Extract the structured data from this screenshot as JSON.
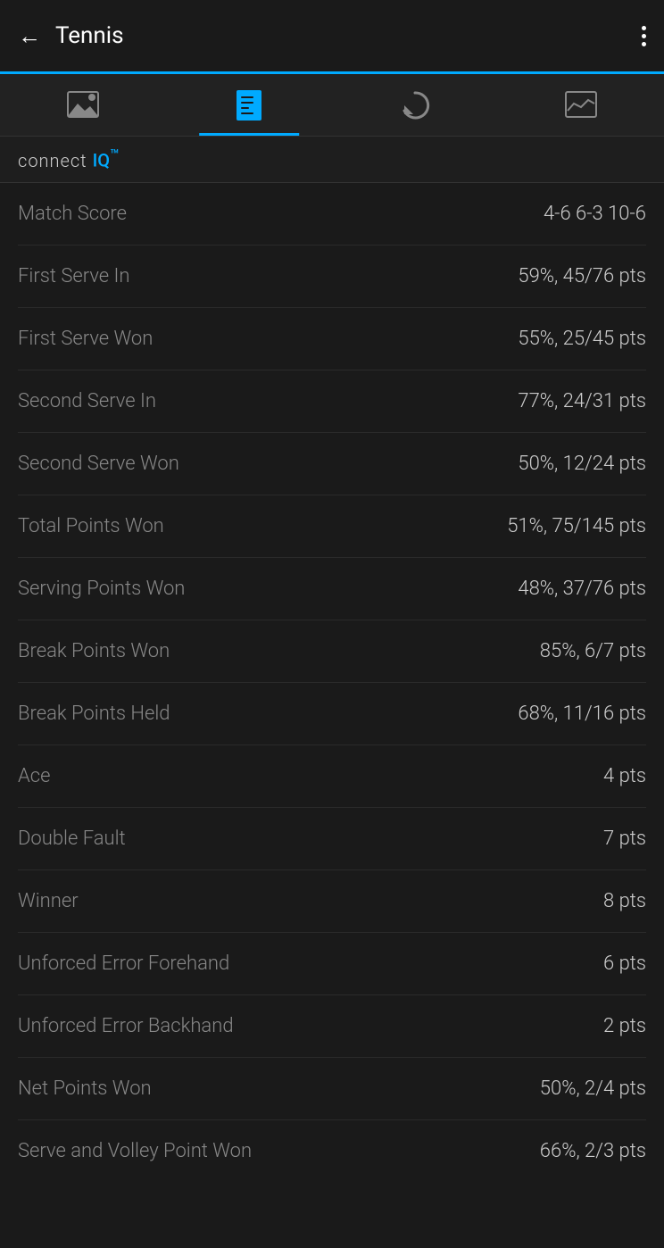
{
  "header": {
    "back_label": "←",
    "title": "Tennis",
    "more_icon": "more-options-icon"
  },
  "tabs": [
    {
      "id": "photo",
      "label": "Photo Tab",
      "active": false
    },
    {
      "id": "list",
      "label": "List Tab",
      "active": true
    },
    {
      "id": "refresh",
      "label": "Refresh Tab",
      "active": false
    },
    {
      "id": "chart",
      "label": "Chart Tab",
      "active": false
    }
  ],
  "branding": {
    "connect": "connect",
    "iq": "IQ",
    "tm": "™"
  },
  "stats": [
    {
      "label": "Match Score",
      "value": "4-6 6-3 10-6"
    },
    {
      "label": "First Serve In",
      "value": "59%, 45/76 pts"
    },
    {
      "label": "First Serve Won",
      "value": "55%, 25/45 pts"
    },
    {
      "label": "Second Serve In",
      "value": "77%, 24/31 pts"
    },
    {
      "label": "Second Serve Won",
      "value": "50%, 12/24 pts"
    },
    {
      "label": "Total Points Won",
      "value": "51%, 75/145 pts"
    },
    {
      "label": "Serving Points Won",
      "value": "48%, 37/76 pts"
    },
    {
      "label": "Break Points Won",
      "value": "85%, 6/7 pts"
    },
    {
      "label": "Break Points Held",
      "value": "68%, 11/16 pts"
    },
    {
      "label": "Ace",
      "value": "4 pts"
    },
    {
      "label": "Double Fault",
      "value": "7 pts"
    },
    {
      "label": "Winner",
      "value": "8 pts"
    },
    {
      "label": "Unforced Error Forehand",
      "value": "6 pts"
    },
    {
      "label": "Unforced Error Backhand",
      "value": "2 pts"
    },
    {
      "label": "Net Points Won",
      "value": "50%, 2/4 pts"
    },
    {
      "label": "Serve and Volley Point Won",
      "value": "66%, 2/3 pts"
    }
  ]
}
